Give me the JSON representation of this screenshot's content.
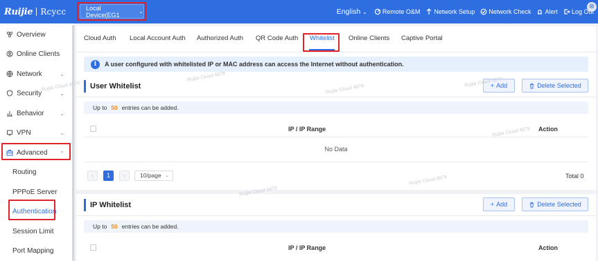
{
  "header": {
    "logo_brand": "Ruijie",
    "logo_product": "Rcycc",
    "device_selector": "Local Device(EG1",
    "language": "English",
    "remote_om": "Remote O&M",
    "network_setup": "Network Setup",
    "network_check": "Network Check",
    "alert": "Alert",
    "logout": "Log Out",
    "bar_color": "#2f6ee0"
  },
  "sidebar": {
    "items": [
      {
        "label": "Overview",
        "icon": "overview-icon"
      },
      {
        "label": "Online Clients",
        "icon": "online-clients-icon"
      },
      {
        "label": "Network",
        "icon": "globe-icon"
      },
      {
        "label": "Security",
        "icon": "shield-icon"
      },
      {
        "label": "Behavior",
        "icon": "chart-icon"
      },
      {
        "label": "VPN",
        "icon": "vpn-icon"
      },
      {
        "label": "Advanced",
        "icon": "briefcase-icon"
      },
      {
        "label": "Routing"
      },
      {
        "label": "PPPoE Server"
      },
      {
        "label": "Authentication"
      },
      {
        "label": "Session Limit"
      },
      {
        "label": "Port Mapping"
      }
    ]
  },
  "tabs": [
    {
      "label": "Cloud Auth"
    },
    {
      "label": "Local Account Auth"
    },
    {
      "label": "Authorized Auth"
    },
    {
      "label": "QR Code Auth"
    },
    {
      "label": "Whitelist",
      "active": true
    },
    {
      "label": "Online Clients"
    },
    {
      "label": "Captive Portal"
    }
  ],
  "info": {
    "text": "A user configured with whitelisted IP or MAC address can access the Internet without authentication."
  },
  "user_whitelist": {
    "title": "User Whitelist",
    "add_label": "Add",
    "delete_label": "Delete Selected",
    "limit_prefix": "Up to",
    "limit_value": "50",
    "limit_suffix": "entries can be added.",
    "col_range": "IP / IP Range",
    "col_action": "Action",
    "empty_text": "No Data",
    "page_current": "1",
    "page_size": "10/page",
    "total": "Total 0"
  },
  "ip_whitelist": {
    "title": "IP Whitelist",
    "add_label": "Add",
    "delete_label": "Delete Selected",
    "limit_prefix": "Up to",
    "limit_value": "50",
    "limit_suffix": "entries can be added.",
    "col_range": "IP / IP Range",
    "col_action": "Action"
  },
  "watermark": "Ruijie Cloud 4879"
}
